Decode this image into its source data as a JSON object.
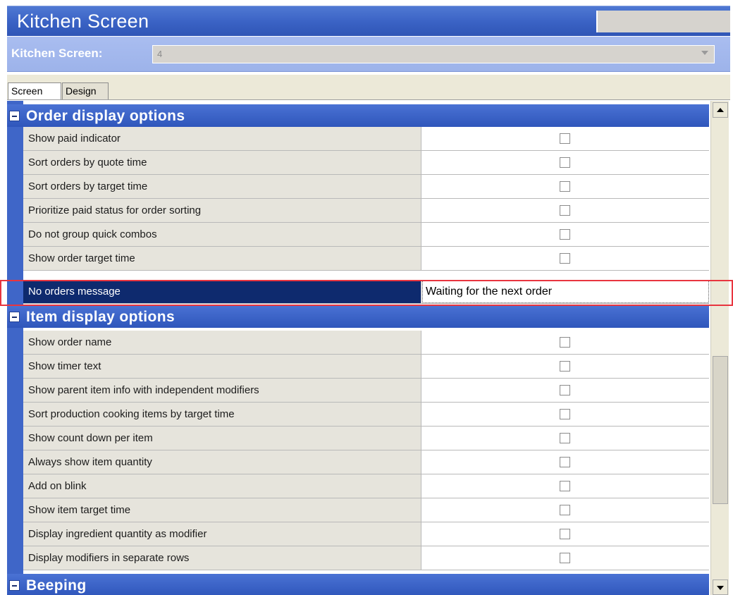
{
  "window": {
    "title": "Kitchen Screen"
  },
  "selector": {
    "label": "Kitchen Screen:",
    "value": "4"
  },
  "tabs": [
    {
      "label": "Screen",
      "active": true
    },
    {
      "label": "Design",
      "active": false
    }
  ],
  "categories": {
    "order": {
      "label": "Order display options"
    },
    "item": {
      "label": "Item display options"
    },
    "beeping": {
      "label": "Beeping"
    }
  },
  "order_rows": [
    {
      "label": "Show paid indicator",
      "checked": false
    },
    {
      "label": "Sort orders by quote time",
      "checked": false
    },
    {
      "label": "Sort orders by target time",
      "checked": false
    },
    {
      "label": "Prioritize paid status for order sorting",
      "checked": false
    },
    {
      "label": "Do not group quick combos",
      "checked": false
    },
    {
      "label": "Show order target time",
      "checked": false
    }
  ],
  "no_orders": {
    "label": "No orders message",
    "value": "Waiting for the next order"
  },
  "item_rows": [
    {
      "label": "Show order name",
      "checked": false
    },
    {
      "label": "Show timer text",
      "checked": false
    },
    {
      "label": "Show parent item info with independent modifiers",
      "checked": false
    },
    {
      "label": "Sort production cooking items by target time",
      "checked": false
    },
    {
      "label": "Show count down per item",
      "checked": false
    },
    {
      "label": "Always show item quantity",
      "checked": false
    },
    {
      "label": "Add on blink",
      "checked": false
    },
    {
      "label": "Show item target time",
      "checked": false
    },
    {
      "label": "Display ingredient quantity as modifier",
      "checked": false
    },
    {
      "label": "Display modifiers in separate rows",
      "checked": false
    }
  ],
  "colors": {
    "header_blue": "#3a62c4",
    "selected_row": "#0e2a6e",
    "highlight_box": "#e8353f"
  }
}
